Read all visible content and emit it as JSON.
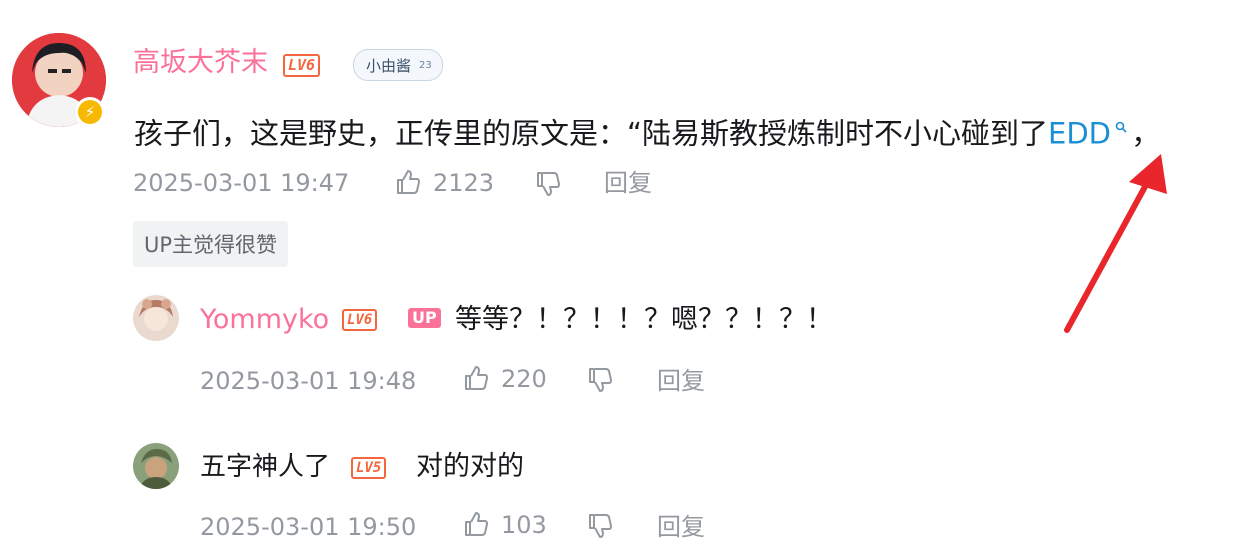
{
  "main_comment": {
    "username": "高坂大芥末",
    "level": "LV6",
    "fan_badge": {
      "name": "小由酱",
      "level": "23"
    },
    "text": "孩子们，这是野史，正传里的原文是：“陆易斯教授炼制时不小心碰到了",
    "link_text": "EDD",
    "text_suffix": "，",
    "timestamp": "2025-03-01 19:47",
    "likes": "2123",
    "reply_label": "回复",
    "up_liked_label": "UP主觉得很赞"
  },
  "replies": [
    {
      "username": "Yommyko",
      "level": "LV6",
      "up_tag": "UP",
      "text": "等等？！？！！？嗯？？！？！",
      "timestamp": "2025-03-01 19:48",
      "likes": "220",
      "reply_label": "回复"
    },
    {
      "username": "五字神人了",
      "level": "LV5",
      "text": "对的对的",
      "timestamp": "2025-03-01 19:50",
      "likes": "103",
      "reply_label": "回复"
    }
  ],
  "colors": {
    "username_pink": "#fb7299",
    "level_orange": "#f4663d",
    "link_blue": "#1b8fd6",
    "meta_gray": "#9499a0",
    "arrow_red": "#e8262b"
  },
  "icons": [
    "thumbs-up-icon",
    "thumbs-down-icon",
    "search-icon",
    "lightning-icon",
    "red-arrow-annotation"
  ]
}
